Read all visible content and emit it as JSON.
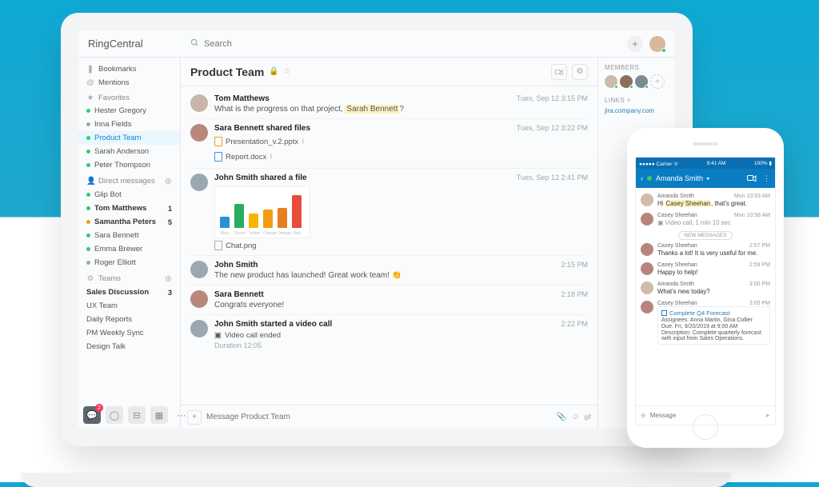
{
  "app": {
    "brand": "RingCentral",
    "search_placeholder": "Search"
  },
  "nav": {
    "badge": "2"
  },
  "sidebar": {
    "bookmarks": "Bookmarks",
    "mentions": "Mentions",
    "favorites_label": "Favorites",
    "favorites": [
      "Hester Gregory",
      "Inna Fields",
      "Product Team",
      "Sarah Anderson",
      "Peter Thompson"
    ],
    "dm_label": "Direct messages",
    "dms": [
      {
        "name": "Glip Bot"
      },
      {
        "name": "Tom Matthews",
        "badge": "1"
      },
      {
        "name": "Samantha Peters",
        "badge": "5"
      },
      {
        "name": "Sara Bennett"
      },
      {
        "name": "Emma Brewer"
      },
      {
        "name": "Roger Elliott"
      }
    ],
    "teams_label": "Teams",
    "teams": [
      {
        "name": "Sales Discussion",
        "badge": "3"
      },
      {
        "name": "UX Team"
      },
      {
        "name": "Daily Reports"
      },
      {
        "name": "PM Weekly Sync"
      },
      {
        "name": "Design Talk"
      }
    ]
  },
  "conversation": {
    "title": "Product Team",
    "composer_placeholder": "Message Product Team",
    "gif_label": "gif",
    "messages": [
      {
        "author": "Tom Matthews",
        "time": "Tues, Sep 12 3:15 PM",
        "text_before": "What is the progress on that project, ",
        "mention": "Sarah Bennett",
        "text_after": "?"
      },
      {
        "author": "Sara Bennett shared files",
        "time": "Tues, Sep 12 3:22 PM",
        "files": [
          "Presentation_v.2.pptx",
          "Report.docx"
        ]
      },
      {
        "author": "John Smith shared a file",
        "time": "Tues, Sep 12 2:41 PM",
        "file": "Chat.png",
        "chart_labels": [
          "Blue",
          "Green",
          "Yellow",
          "Orange",
          "Orange",
          "Red"
        ]
      },
      {
        "author": "John Smith",
        "time": "2:15 PM",
        "text": "The new product has launched! Great work team!"
      },
      {
        "author": "Sara Bennett",
        "time": "2:18 PM",
        "text": "Congrats everyone!"
      },
      {
        "author": "John Smith started a video call",
        "time": "2:22 PM",
        "event": "Video call ended",
        "duration": "Duration 12:05"
      }
    ]
  },
  "rail": {
    "members_label": "MEMBERS",
    "links_label": "LINKS",
    "link": "jira.company.com"
  },
  "phone": {
    "status": {
      "carrier": "●●●●● Carrier ᯤ",
      "time": "9:41 AM",
      "battery": "100% ▮"
    },
    "title": "Amanda Smith",
    "composer_placeholder": "Message",
    "divider": "NEW MESSAGES",
    "messages": [
      {
        "author": "Amanda Smith",
        "time": "Mon 10:53 AM",
        "pre": "Hi ",
        "hl": "Casey Sheehan",
        "post": ", that's great."
      },
      {
        "author": "Casey Sheehan",
        "time": "Mon 10:58 AM",
        "text": "Video call, 1 min 10 sec"
      },
      {
        "author": "Casey Sheehan",
        "time": "2:57 PM",
        "text": "Thanks a lot! It is very useful for me."
      },
      {
        "author": "Casey Sheehan",
        "time": "2:59 PM",
        "text": "Happy to help!"
      },
      {
        "author": "Amanda Smith",
        "time": "3:00 PM",
        "text": "What's new today?"
      },
      {
        "author": "Casey Sheehan",
        "time": "3:05 PM",
        "task": {
          "title": "Complete Q4 Forecast",
          "assignees": "Assignees: Anna Martin, Gina Collier",
          "due": "Due: Fri, 9/20/2019 at 9:00 AM",
          "desc": "Description: Complete quarterly forecast with input from Sales Operations."
        }
      }
    ]
  },
  "chart_data": {
    "type": "bar",
    "title": "",
    "categories": [
      "Blue",
      "Green",
      "Yellow",
      "Orange",
      "Orange",
      "Red"
    ],
    "values": [
      30,
      65,
      40,
      50,
      55,
      90
    ],
    "colors": [
      "#2b91d6",
      "#27ae60",
      "#f7b500",
      "#f39c12",
      "#e67e22",
      "#e74c3c"
    ],
    "ylim": [
      0,
      100
    ],
    "xlabel": "",
    "ylabel": ""
  }
}
